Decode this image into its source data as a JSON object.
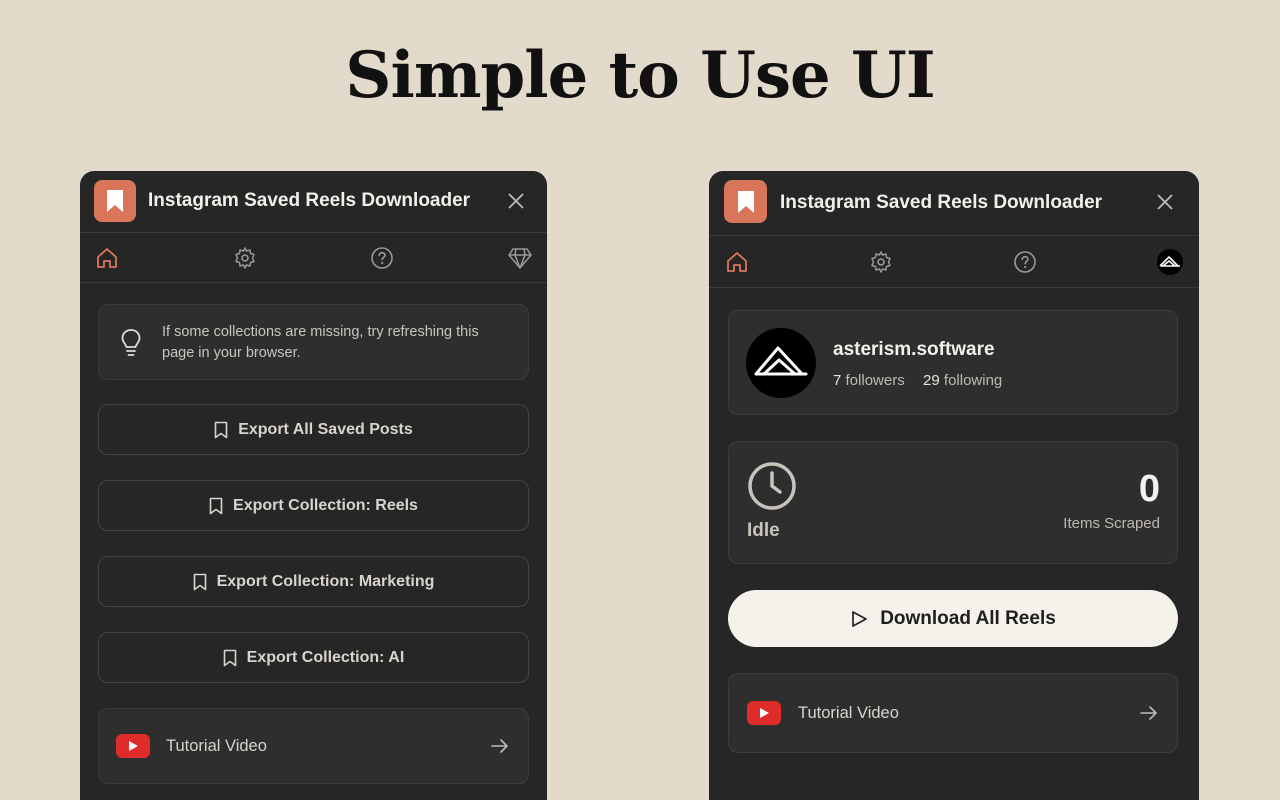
{
  "headline": "Simple to Use UI",
  "app": {
    "title": "Instagram Saved Reels Downloader"
  },
  "left": {
    "tip": "If some collections are missing, try refreshing this page in your browser.",
    "tip_line1": "If some collections are missing, try refreshing this",
    "tip_line2": "page in your browser.",
    "buttons": [
      "Export All Saved Posts",
      "Export Collection: Reels",
      "Export Collection: Marketing",
      "Export Collection: AI"
    ],
    "tutorial": "Tutorial Video"
  },
  "right": {
    "profile": {
      "username": "asterism.software",
      "followers_count": "7",
      "followers_label": "followers",
      "following_count": "29",
      "following_label": "following"
    },
    "status": {
      "state": "Idle",
      "count": "0",
      "count_label": "Items Scraped"
    },
    "download_button": "Download All Reels",
    "tutorial": "Tutorial Video"
  },
  "icons": {
    "tab_home": "home-icon",
    "tab_settings": "gear-icon",
    "tab_help": "help-circle-icon",
    "tab_premium": "diamond-icon",
    "tab_account": "avatar-icon",
    "close": "close-icon",
    "bookmark": "bookmark-icon",
    "tip": "lightbulb-icon",
    "clock": "clock-icon",
    "play": "play-icon",
    "youtube": "youtube-icon",
    "arrow": "arrow-right-icon"
  },
  "colors": {
    "background": "#e2dacb",
    "panel": "#262626",
    "card": "#2e2e2e",
    "accent": "#d9765a",
    "youtube_red": "#e02b2b",
    "primary_button": "#f5f2ec"
  }
}
